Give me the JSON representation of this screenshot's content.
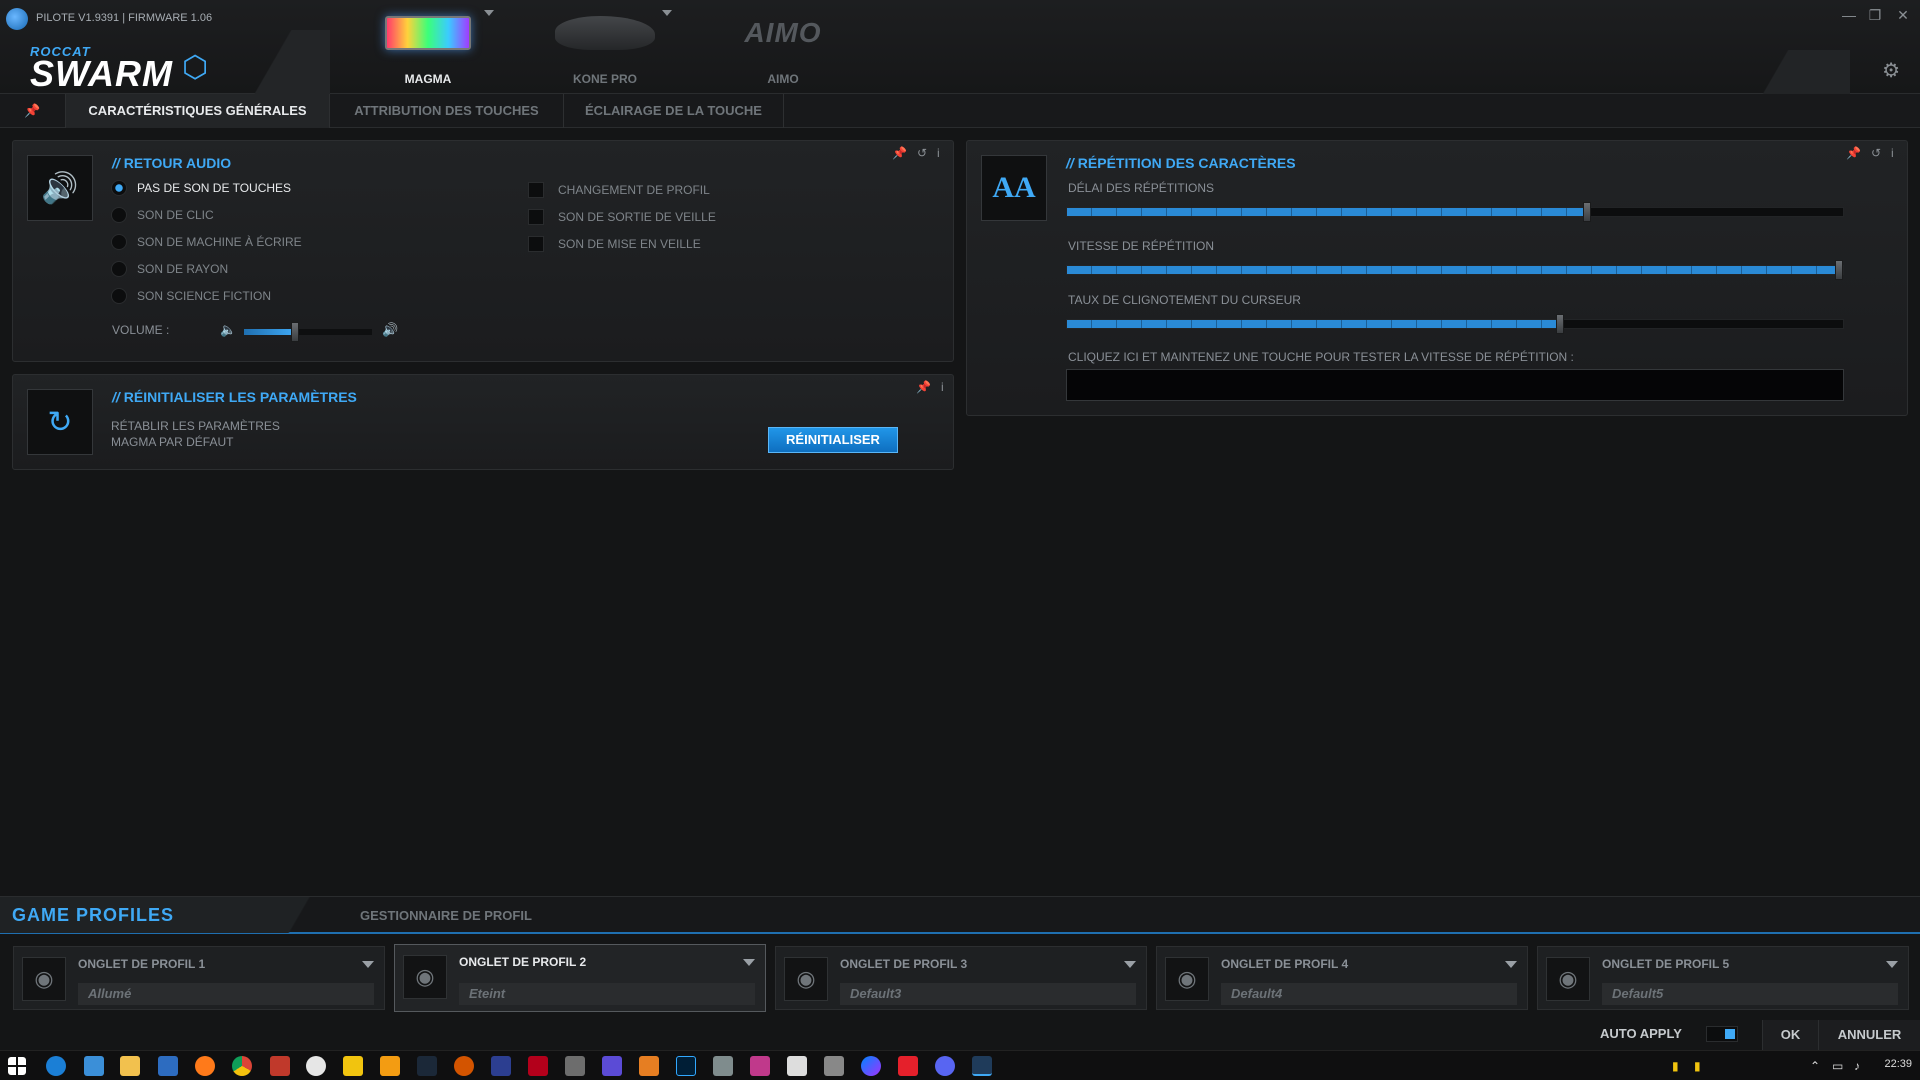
{
  "window": {
    "version": "PILOTE V1.9391 | FIRMWARE 1.06",
    "brand_small": "ROCCAT",
    "brand_big": "SWARM",
    "minimize": "—",
    "restore": "❐",
    "close": "✕"
  },
  "devices": [
    {
      "name": "MAGMA",
      "active": true
    },
    {
      "name": "KONE PRO",
      "active": false
    },
    {
      "name": "AIMO",
      "active": false,
      "logo_text": "AIMO"
    }
  ],
  "tabs": [
    {
      "label": "CARACTÉRISTIQUES GÉNÉRALES",
      "active": true
    },
    {
      "label": "ATTRIBUTION DES TOUCHES",
      "active": false
    },
    {
      "label": "ÉCLAIRAGE DE LA TOUCHE",
      "active": false
    }
  ],
  "audio": {
    "title": "RETOUR AUDIO",
    "options": [
      {
        "label": "PAS DE SON DE TOUCHES",
        "selected": true
      },
      {
        "label": "SON DE CLIC",
        "selected": false
      },
      {
        "label": "SON DE MACHINE À ÉCRIRE",
        "selected": false
      },
      {
        "label": "SON DE RAYON",
        "selected": false
      },
      {
        "label": "SON SCIENCE FICTION",
        "selected": false
      }
    ],
    "checkboxes": [
      {
        "label": "CHANGEMENT DE PROFIL",
        "checked": false
      },
      {
        "label": "SON DE SORTIE DE VEILLE",
        "checked": false
      },
      {
        "label": "SON DE MISE EN VEILLE",
        "checked": false
      }
    ],
    "volume_label": "VOLUME :",
    "volume_level": 0.4
  },
  "reset": {
    "title": "RÉINITIALISER LES PARAMÈTRES",
    "desc_line1": "RÉTABLIR LES PARAMÈTRES",
    "desc_line2": "MAGMA PAR DÉFAUT",
    "button": "RÉINITIALISER"
  },
  "repeat": {
    "title": "RÉPÉTITION DES CARACTÈRES",
    "delay_label": "DÉLAI DES RÉPÉTITIONS",
    "delay_level": 0.67,
    "speed_label": "VITESSE DE RÉPÉTITION",
    "speed_level": 1.0,
    "blink_label": "TAUX DE CLIGNOTEMENT DU CURSEUR",
    "blink_level": 0.635,
    "test_label": "CLIQUEZ ICI ET MAINTENEZ UNE TOUCHE POUR TESTER LA VITESSE DE RÉPÉTITION :",
    "test_value": ""
  },
  "game_profiles": {
    "title": "GAME PROFILES",
    "manager_tab": "GESTIONNAIRE DE PROFIL",
    "profiles": [
      {
        "title": "ONGLET DE PROFIL 1",
        "name": "Allumé",
        "selected": false
      },
      {
        "title": "ONGLET DE PROFIL 2",
        "name": "Eteint",
        "selected": true
      },
      {
        "title": "ONGLET DE PROFIL 3",
        "name": "Default3",
        "selected": false
      },
      {
        "title": "ONGLET DE PROFIL 4",
        "name": "Default4",
        "selected": false
      },
      {
        "title": "ONGLET DE PROFIL 5",
        "name": "Default5",
        "selected": false
      }
    ]
  },
  "footer": {
    "auto_apply": "AUTO APPLY",
    "auto_apply_on": true,
    "ok": "OK",
    "cancel": "ANNULER"
  },
  "taskbar": {
    "clock": "22:39"
  },
  "colors": {
    "accent": "#3fa9f5",
    "background": "#141516"
  }
}
